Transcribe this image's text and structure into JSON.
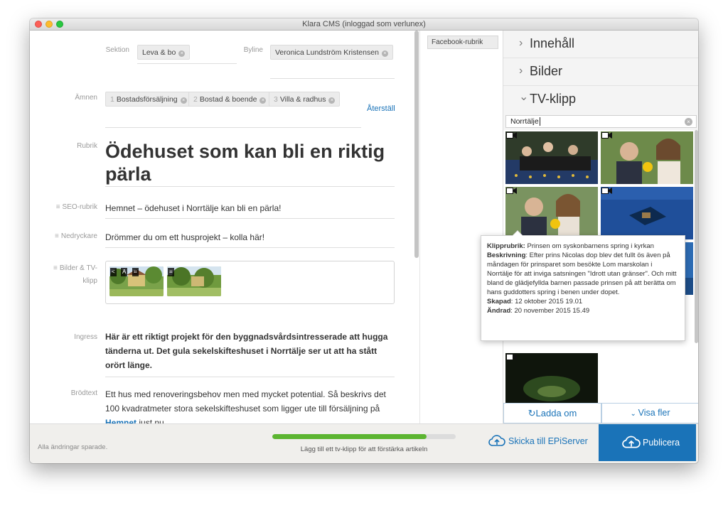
{
  "window": {
    "title": "Klara CMS (inloggad som verlunex)"
  },
  "editor": {
    "sektion_label": "Sektion",
    "sektion_value": "Leva & bo",
    "byline_label": "Byline",
    "byline_value": "Veronica Lundström Kristensen",
    "amnen_label": "Ämnen",
    "amnen_tags": [
      {
        "num": "1",
        "label": "Bostadsförsäljning"
      },
      {
        "num": "2",
        "label": "Bostad & boende"
      },
      {
        "num": "3",
        "label": "Villa & radhus"
      }
    ],
    "reset_label": "Återställ",
    "rubrik_label": "Rubrik",
    "rubrik_value": "Ödehuset som kan bli en riktig pärla",
    "seo_label": "SEO-rubrik",
    "seo_value": "Hemnet – ödehuset i Norrtälje kan bli en pärla!",
    "nedryckare_label": "Nedryckare",
    "nedryckare_value": "Drömmer du om ett husprojekt – kolla här!",
    "bilder_label_1": "Bilder & TV-",
    "bilder_label_2": "klipp",
    "ingress_label": "Ingress",
    "ingress_value": "Här är ett riktigt projekt för den byggnadsvårdsintresserade att hugga tänderna ut. Det gula sekelskifteshuset i Norrtälje ser ut att ha stått orört länge.",
    "brodtext_label": "Brödtext",
    "brodtext_before": "Ett hus med renoveringsbehov men med mycket potential. Så beskrivs det 100 kvadratmeter stora sekelskifteshuset som ligger ute till försäljning på ",
    "brodtext_link": "Hemnet",
    "brodtext_after": " just nu."
  },
  "middle": {
    "fb_label": "Facebook-rubrik"
  },
  "sidebar": {
    "sections": [
      {
        "label": "Innehåll",
        "chevron": "›"
      },
      {
        "label": "Bilder",
        "chevron": "›"
      },
      {
        "label": "TV-klipp",
        "chevron": "⌄"
      }
    ],
    "search_value": "Norrtälje",
    "reload_label": "Ladda om",
    "more_label": "Visa fler"
  },
  "tooltip": {
    "klipprubrik_label": "Klipprubrik:",
    "klipprubrik_value": " Prinsen om syskonbarnens spring i kyrkan",
    "beskrivning_label": "Beskrivning",
    "beskrivning_value": ": Efter prins Nicolas dop blev det fullt ös även på måndagen för prinsparet som besökte Lom marskolan i Norrtälje för att inviga satsningen \"Idrott utan gränser\". Och mitt bland de glädjefyllda barnen passade prinsen på att berätta om hans guddotters spring i benen under dopet.",
    "skapad_label": "Skapad",
    "skapad_value": ": 12 oktober 2015 19.01",
    "andrad_label": "Ändrad",
    "andrad_value": ": 20 november 2015 15.49"
  },
  "footer": {
    "saved": "Alla ändringar sparade.",
    "progress": 0.84,
    "hint": "Lägg till ett tv-klipp för att förstärka artikeln",
    "epi_label": "Skicka till EPiServer",
    "publish_label": "Publicera"
  },
  "colors": {
    "accent": "#1a73b8",
    "progress": "#5cb531"
  }
}
